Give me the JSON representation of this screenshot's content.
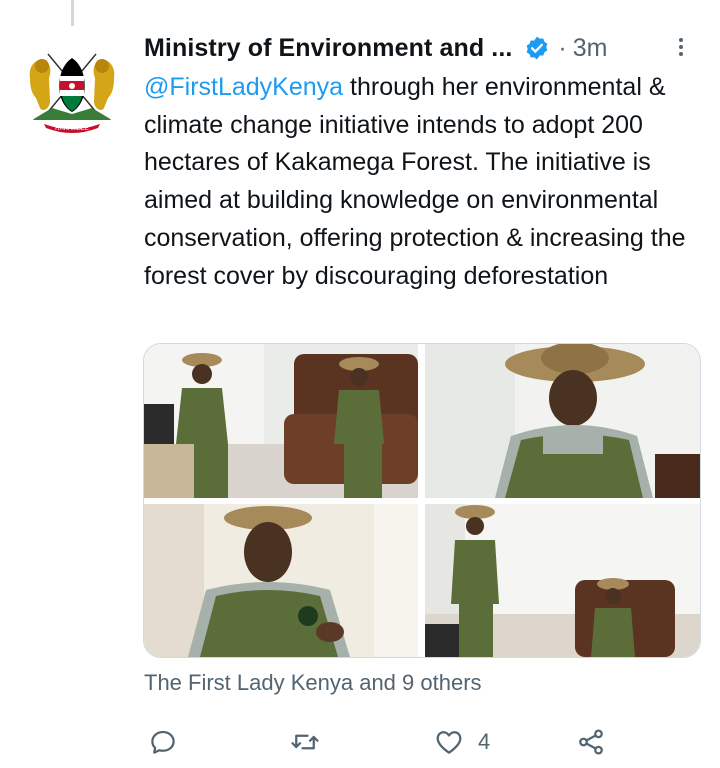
{
  "tweet": {
    "author_name": "Ministry of Environment and ...",
    "verified_icon": "verified-badge-icon",
    "separator": "·",
    "timestamp": "3m",
    "mention": "@FirstLadyKenya",
    "text_rest": " through her environmental & climate change initiative intends to adopt 200 hectares of Kakamega Forest. The initiative is aimed at building knowledge on environmental conservation, offering protection & increasing the forest cover by discouraging deforestation",
    "social_context": "The First Lady Kenya and 9 others"
  },
  "actions": {
    "reply_icon": "reply-icon",
    "retweet_icon": "retweet-icon",
    "like_icon": "heart-icon",
    "like_count": "4",
    "share_icon": "share-icon"
  },
  "colors": {
    "accent": "#1d9bf0",
    "text": "#0f1419",
    "secondary": "#536471",
    "uniform_green": "#5b6e3a"
  }
}
